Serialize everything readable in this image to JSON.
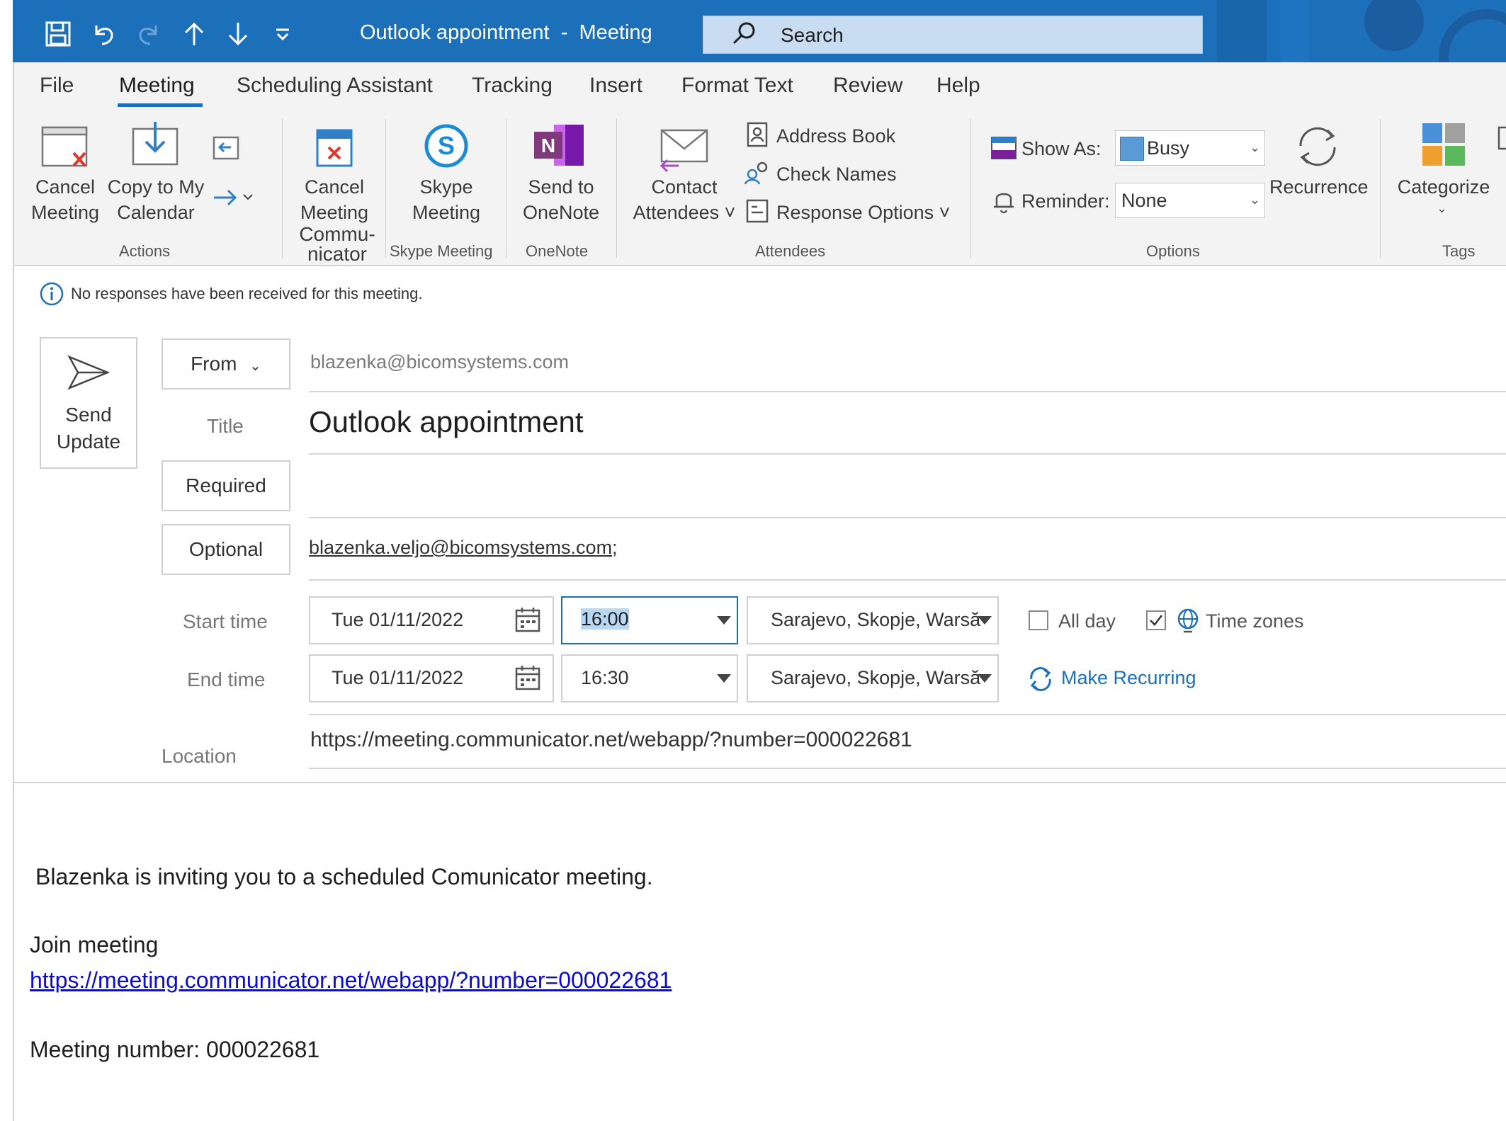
{
  "window": {
    "title": "Outlook appointment  -  Meeting",
    "search_placeholder": "Search"
  },
  "tabs": [
    "File",
    "Meeting",
    "Scheduling Assistant",
    "Tracking",
    "Insert",
    "Format Text",
    "Review",
    "Help"
  ],
  "ribbon": {
    "actions": {
      "cancel_line1": "Cancel",
      "cancel_line2": "Meeting",
      "copy_line1": "Copy to My",
      "copy_line2": "Calendar",
      "group": "Actions"
    },
    "communicator": {
      "line1": "Cancel",
      "line2": "Meeting",
      "group_line1": "Commu-",
      "group_line2": "nicator"
    },
    "skype": {
      "line1": "Skype",
      "line2": "Meeting",
      "group": "Skype Meeting"
    },
    "onenote": {
      "line1": "Send to",
      "line2": "OneNote",
      "group": "OneNote"
    },
    "attendees": {
      "contact_line1": "Contact",
      "contact_line2": "Attendees ˅",
      "address_book": "Address Book",
      "check_names": "Check Names",
      "response_options": "Response Options ˅",
      "group": "Attendees"
    },
    "options": {
      "show_as_label": "Show As:",
      "show_as_value": "Busy",
      "reminder_label": "Reminder:",
      "reminder_value": "None",
      "recurrence": "Recurrence",
      "group": "Options"
    },
    "tags": {
      "categorize": "Categorize",
      "group": "Tags"
    }
  },
  "info_bar": "No responses have been received for this meeting.",
  "form": {
    "send_line1": "Send",
    "send_line2": "Update",
    "from_label": "From",
    "from_value": "blazenka@bicomsystems.com",
    "title_label": "Title",
    "title_value": "Outlook appointment",
    "required_label": "Required",
    "required_value": "",
    "optional_label": "Optional",
    "optional_value": "blazenka.veljo@bicomsystems.com;",
    "start_label": "Start time",
    "start_date": "Tue 01/11/2022",
    "start_time": "16:00",
    "start_tz": "Sarajevo, Skopje, Warsă",
    "end_label": "End time",
    "end_date": "Tue 01/11/2022",
    "end_time": "16:30",
    "end_tz": "Sarajevo, Skopje, Warsă",
    "all_day_label": "All day",
    "all_day_checked": false,
    "time_zones_label": "Time zones",
    "time_zones_checked": true,
    "make_recurring": "Make Recurring",
    "location_label": "Location",
    "location_value": "https://meeting.communicator.net/webapp/?number=000022681"
  },
  "body": {
    "invite_text": "Blazenka is inviting you to a scheduled Comunicator meeting.",
    "join_label": "Join meeting",
    "join_link": "https://meeting.communicator.net/webapp/?number=000022681",
    "meeting_number": "Meeting number: 000022681"
  },
  "colors": {
    "accent": "#1c6fb9",
    "link": "#0b0bd9",
    "search_bg": "#c9ddf2",
    "busy_swatch": "#5b9bd5"
  }
}
